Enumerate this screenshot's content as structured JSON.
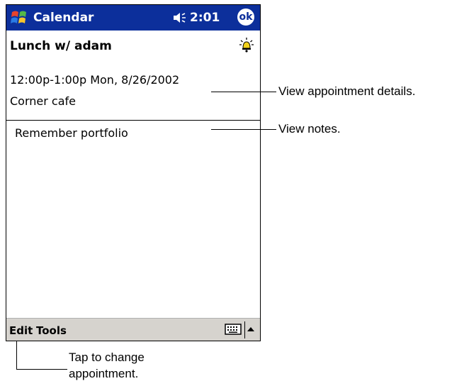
{
  "titlebar": {
    "app_title": "Calendar",
    "clock": "2:01",
    "ok_label": "ok"
  },
  "appointment": {
    "subject": "Lunch w/ adam",
    "time": "12:00p-1:00p Mon, 8/26/2002",
    "location": "Corner cafe",
    "notes": "Remember portfolio"
  },
  "menubar": {
    "edit_label": "Edit",
    "tools_label": "Tools"
  },
  "callouts": {
    "details": "View appointment details.",
    "notes": "View notes.",
    "edit_line1": "Tap to change",
    "edit_line2": "appointment."
  },
  "colors": {
    "titlebar_bg": "#0c2f9b",
    "menubar_bg": "#d6d3ce"
  },
  "icons": [
    "windows-start-icon",
    "speaker-icon",
    "ok-icon",
    "alarm-bell-icon",
    "keyboard-icon",
    "sip-up-arrow-icon"
  ]
}
